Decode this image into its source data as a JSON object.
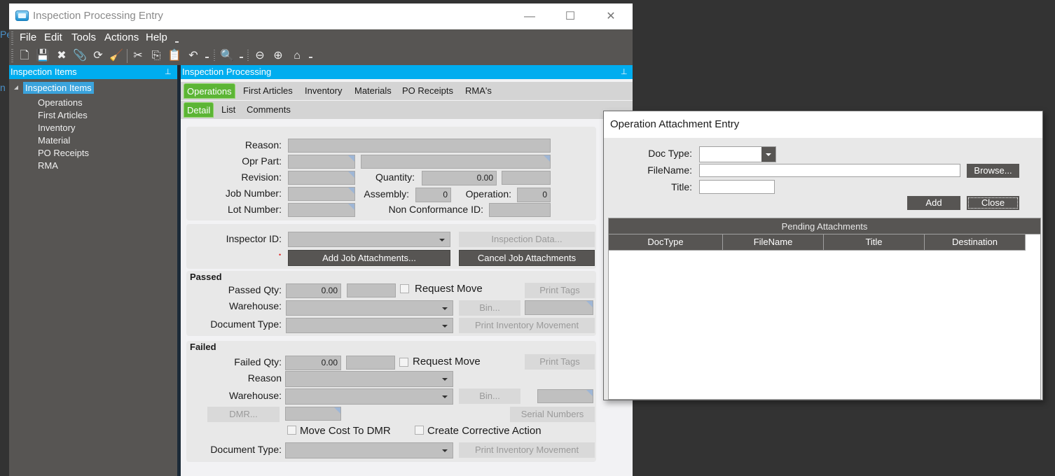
{
  "background_text": "Per",
  "background_text2": "n",
  "window": {
    "title": "Inspection Processing Entry",
    "minimize": "—",
    "maximize": "☐",
    "close": "✕"
  },
  "menu": [
    "File",
    "Edit",
    "Tools",
    "Actions",
    "Help"
  ],
  "menu_overflow": "⌄",
  "toolbar": {
    "new": "🗋",
    "save": "💾",
    "delete": "✖",
    "attach": "📎",
    "refresh": "⟳",
    "clear": "🧹",
    "cut": "✂",
    "copy": "⎘",
    "paste": "📋",
    "undo": "↶",
    "search": "🔍",
    "back": "⊖",
    "forward": "⊕",
    "home": "⌂"
  },
  "left_pane": {
    "title": "Inspection Items",
    "pin": "⊥",
    "tree_root": "Inspection Items",
    "tree_children": [
      "Operations",
      "First Articles",
      "Inventory",
      "Material",
      "PO Receipts",
      "RMA"
    ]
  },
  "right_pane": {
    "title": "Inspection Processing",
    "pin": "⊥",
    "tabs": [
      "Operations",
      "First Articles",
      "Inventory",
      "Materials",
      "PO Receipts",
      "RMA's"
    ],
    "active_tab": "Operations",
    "subtabs": [
      "Detail",
      "List",
      "Comments"
    ],
    "active_subtab": "Detail"
  },
  "form": {
    "reason_label": "Reason:",
    "reason_value": "",
    "opr_part_label": "Opr Part:",
    "revision_label": "Revision:",
    "quantity_label": "Quantity:",
    "quantity_value": "0.00",
    "job_number_label": "Job Number:",
    "assembly_label": "Assembly:",
    "assembly_value": "0",
    "operation_label": "Operation:",
    "operation_value": "0",
    "lot_number_label": "Lot Number:",
    "nonconf_label": "Non Conformance ID:",
    "inspector_label": "Inspector ID:",
    "inspection_data_btn": "Inspection Data...",
    "required_mark": "•",
    "add_attach_btn": "Add Job Attachments...",
    "cancel_attach_btn": "Cancel Job Attachments",
    "passed": {
      "title": "Passed",
      "qty_label": "Passed Qty:",
      "qty_value": "0.00",
      "request_move": "Request Move",
      "print_tags": "Print Tags",
      "warehouse_label": "Warehouse:",
      "bin_btn": "Bin...",
      "doc_type_label": "Document Type:",
      "print_inv_btn": "Print Inventory Movement"
    },
    "failed": {
      "title": "Failed",
      "qty_label": "Failed Qty:",
      "qty_value": "0.00",
      "request_move": "Request Move",
      "print_tags": "Print Tags",
      "reason_label": "Reason",
      "warehouse_label": "Warehouse:",
      "bin_btn": "Bin...",
      "dmr_btn": "DMR...",
      "serial_btn": "Serial Numbers",
      "move_cost": "Move Cost To DMR",
      "corrective": "Create Corrective Action",
      "doc_type_label": "Document Type:",
      "print_inv_btn": "Print Inventory Movement"
    }
  },
  "dialog": {
    "title": "Operation Attachment Entry",
    "doc_type_label": "Doc Type:",
    "doc_type_value": "",
    "filename_label": "FileName:",
    "filename_value": "",
    "title_label": "Title:",
    "title_value": "",
    "browse_btn": "Browse...",
    "add_btn": "Add",
    "close_btn": "Close",
    "grid_band": "Pending Attachments",
    "columns": [
      "DocType",
      "FileName",
      "Title",
      "Destination"
    ],
    "rows": []
  }
}
